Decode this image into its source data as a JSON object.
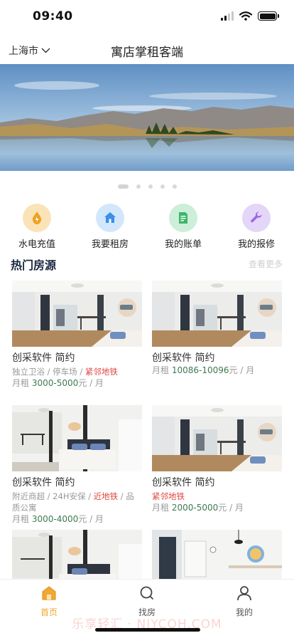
{
  "status_bar": {
    "time": "09:40"
  },
  "header": {
    "city": "上海市",
    "title": "寓店掌租客端"
  },
  "banner": {
    "slide_count": 5,
    "active_index": 0
  },
  "quick_menu": [
    {
      "label": "水电充值",
      "icon": "flame-icon",
      "bg": "#fbe3b8",
      "fg": "#f0a020"
    },
    {
      "label": "我要租房",
      "icon": "house-icon",
      "bg": "#d2e7fb",
      "fg": "#3b8fe8"
    },
    {
      "label": "我的账单",
      "icon": "bill-icon",
      "bg": "#cdeed9",
      "fg": "#3cb66a"
    },
    {
      "label": "我的报修",
      "icon": "wrench-icon",
      "bg": "#e3d6f8",
      "fg": "#9a67e0"
    }
  ],
  "hot": {
    "title": "热门房源",
    "more": "查看更多"
  },
  "listings": [
    {
      "name": "创采软件 简约",
      "tags_plain": "独立卫浴 / 停车场 / ",
      "tag_red": "紧邻地铁",
      "tags_extra": "",
      "rent_prefix": "月租 ",
      "rent_value": "3000-5000",
      "rent_suffix": "元 / 月"
    },
    {
      "name": "创采软件 简约",
      "tags_plain": "",
      "tag_red": "",
      "tags_extra": "",
      "rent_prefix": "月租 ",
      "rent_value": "10086-10096",
      "rent_suffix": "元 / 月"
    },
    {
      "name": "创采软件 简约",
      "tags_plain": "附近商超 / 24H安保 / ",
      "tag_red": "近地铁",
      "tags_extra": " / 品质公寓",
      "rent_prefix": "月租 ",
      "rent_value": "3000-4000",
      "rent_suffix": "元 / 月"
    },
    {
      "name": "创采软件 简约",
      "tags_plain": "",
      "tag_red": "紧邻地铁",
      "tags_extra": "",
      "rent_prefix": "月租 ",
      "rent_value": "2000-5000",
      "rent_suffix": "元 / 月"
    }
  ],
  "tabs": [
    {
      "label": "首页",
      "icon": "home-icon",
      "active": true
    },
    {
      "label": "找房",
      "icon": "search-icon",
      "active": false
    },
    {
      "label": "我的",
      "icon": "user-icon",
      "active": false
    }
  ],
  "watermark": "乐享轻汇 · NJYCQH.COM",
  "colors": {
    "accent": "#f0a733",
    "price": "#3d7a50",
    "tag_red": "#e0473f"
  }
}
